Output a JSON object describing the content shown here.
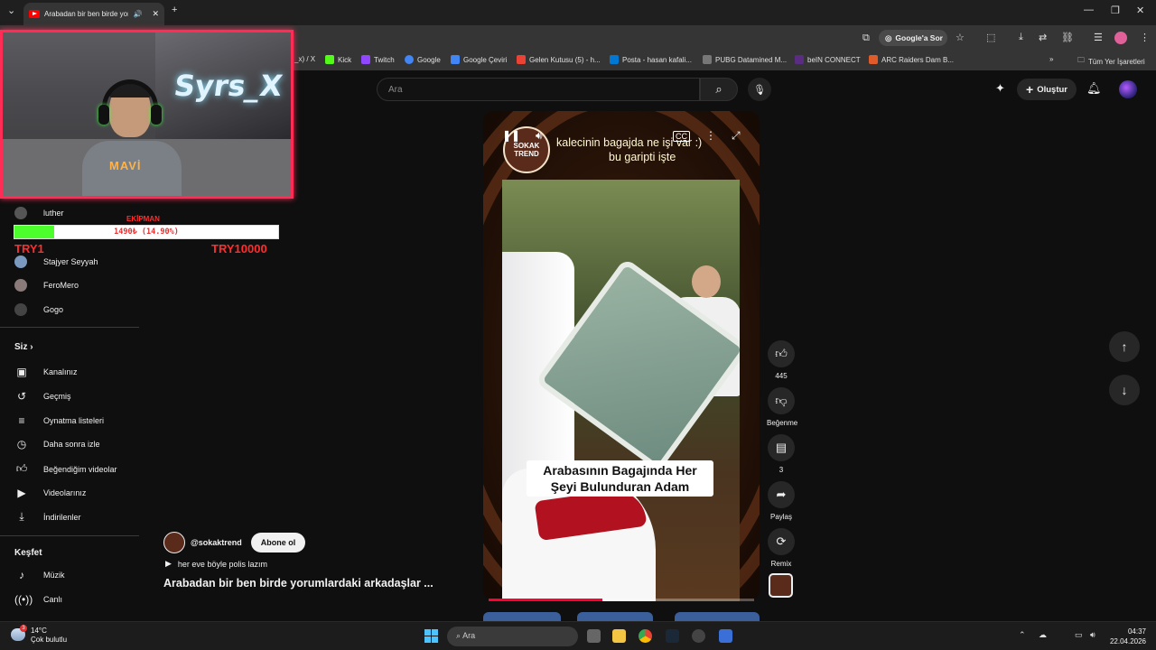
{
  "browser": {
    "tab_title": "Arabadan bir ben birde yorumlardaki arkadaşlar",
    "google_sor": "Google'a Sor",
    "bookmarks": [
      {
        "label": "_x) / X",
        "color": "#000000"
      },
      {
        "label": "Kick",
        "color": "#53fc18"
      },
      {
        "label": "Twitch",
        "color": "#9146ff"
      },
      {
        "label": "Google",
        "color": "#4285f4"
      },
      {
        "label": "Google Çeviri",
        "color": "#4285f4"
      },
      {
        "label": "Gelen Kutusu (5) - h...",
        "color": "#ea4335"
      },
      {
        "label": "Posta - hasan kafali...",
        "color": "#0078d4"
      },
      {
        "label": "PUBG Datamined M...",
        "color": "#777777"
      },
      {
        "label": "beIN CONNECT",
        "color": "#5a2d82"
      },
      {
        "label": "ARC Raiders Dam B...",
        "color": "#e05a2a"
      }
    ],
    "all_bookmarks": "Tüm Yer İşaretleri"
  },
  "header": {
    "search_placeholder": "Ara",
    "create_label": "Oluştur"
  },
  "overlay": {
    "cam_text": "Syrs_X",
    "shirt_text": "MAVİ",
    "goal_title": "EKİPMAN",
    "goal_text": "1490₺ (14.90%)",
    "goal_progress": 14.9,
    "goal_min": "TRY1",
    "goal_max": "TRY10000"
  },
  "sidebar": {
    "subscriptions": [
      {
        "label": "luther"
      },
      {
        "label": "Stajyer Seyyah"
      },
      {
        "label": "FeroMero"
      },
      {
        "label": "Gogo"
      }
    ],
    "you_header": "Siz",
    "you_items": [
      {
        "label": "Kanalınız",
        "icon": "channel-icon"
      },
      {
        "label": "Geçmiş",
        "icon": "history-icon"
      },
      {
        "label": "Oynatma listeleri",
        "icon": "playlist-icon"
      },
      {
        "label": "Daha sonra izle",
        "icon": "clock-icon"
      },
      {
        "label": "Beğendiğim videolar",
        "icon": "thumbs-up-icon"
      },
      {
        "label": "Videolarınız",
        "icon": "video-icon"
      },
      {
        "label": "İndirilenler",
        "icon": "download-icon"
      }
    ],
    "explore_header": "Keşfet",
    "explore_items": [
      {
        "label": "Müzik",
        "icon": "music-icon"
      },
      {
        "label": "Canlı",
        "icon": "live-icon"
      }
    ]
  },
  "video": {
    "caption_top_line1": "kalecinin bagajda ne işi var :)",
    "caption_top_line2": "bu garipti işte",
    "caption_mid": "Arabasının Bagajında Her Şeyi Bulunduran Adam",
    "channel_logo_text": "SOKAK TREND",
    "progress": 0.43,
    "likes": "445",
    "dislike_label": "Beğenme",
    "comments": "3",
    "share_label": "Paylaş",
    "remix_label": "Remix",
    "channel": "@sokaktrend",
    "subscribe_label": "Abone ol",
    "music": "her eve böyle polis lazım",
    "title": "Arabadan bir ben birde yorumlardaki arkadaşlar ..."
  },
  "taskbar": {
    "temp": "14°C",
    "weather": "Çok bulutlu",
    "search_placeholder": "Ara",
    "time": "04:37",
    "date": "22.04.2026",
    "weather_badge": "3"
  }
}
